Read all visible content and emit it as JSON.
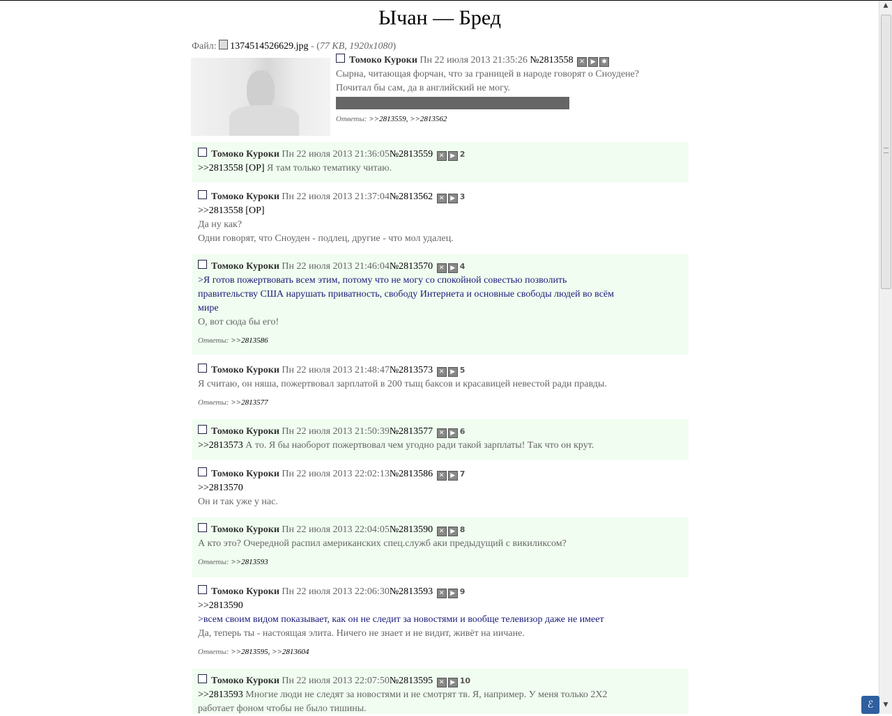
{
  "title": "Ычан — Бред",
  "op": {
    "file_label": "Файл:",
    "file_name": "1374514526629.jpg",
    "file_sep": " - (",
    "file_meta": "77 KB, 1920x1080",
    "file_close": ")",
    "name": "Томоко Куроки",
    "date": "Пн 22 июля 2013 21:35:26",
    "num": "№2813558",
    "lines": [
      "Сырна, читающая форчан, что за границей в народе говорят о Сноудене?",
      "Почитал бы сам, да в английский не могу."
    ],
    "replies_label": "Ответы:",
    "replies": ">>2813559, >>2813562"
  },
  "posts": [
    {
      "name": "Томоко Куроки",
      "date": "Пн 22 июля 2013 21:36:05",
      "num": "№2813559",
      "idx": "2",
      "l1_ref": ">>2813558 [OP]",
      "l1_text": " Я там только тематику читаю."
    },
    {
      "name": "Томоко Куроки",
      "date": "Пн 22 июля 2013 21:37:04",
      "num": "№2813562",
      "idx": "3",
      "l1": ">>2813558 [OP]",
      "l2": "Да ну как?",
      "l3": "Одни говорят, что Сноуден - подлец, другие - что мол удалец."
    },
    {
      "name": "Томоко Куроки",
      "date": "Пн 22 июля 2013 21:46:04",
      "num": "№2813570",
      "idx": "4",
      "quote1": ">Я готов пожертвовать всем этим, потому что не могу со спокойной совестью позволить",
      "quote2": "правительству США нарушать приватность, свободу Интернета и основные свободы людей во всём",
      "quote3": "мире",
      "l2": "О, вот сюда бы его!",
      "replies_label": "Ответы:",
      "replies": ">>2813586"
    },
    {
      "name": "Томоко Куроки",
      "date": "Пн 22 июля 2013 21:48:47",
      "num": "№2813573",
      "idx": "5",
      "l1": "Я считаю, он няша, пожертвовал зарплатой в 200 тыщ баксов и красавицей невестой ради правды.",
      "replies_label": "Ответы:",
      "replies": ">>2813577"
    },
    {
      "name": "Томоко Куроки",
      "date": "Пн 22 июля 2013 21:50:39",
      "num": "№2813577",
      "idx": "6",
      "l1_ref": ">>2813573",
      "l1_text": " А то. Я бы наоборот пожертвовал чем угодно ради такой зарплаты! Так что он крут."
    },
    {
      "name": "Томоко Куроки",
      "date": "Пн 22 июля 2013 22:02:13",
      "num": "№2813586",
      "idx": "7",
      "l1": ">>2813570",
      "l2": "Он и так уже у нас."
    },
    {
      "name": "Томоко Куроки",
      "date": "Пн 22 июля 2013 22:04:05",
      "num": "№2813590",
      "idx": "8",
      "l1": "А кто это? Очередной распил американских спец.служб аки предыдущий с викиликсом?",
      "replies_label": "Ответы:",
      "replies": ">>2813593"
    },
    {
      "name": "Томоко Куроки",
      "date": "Пн 22 июля 2013 22:06:30",
      "num": "№2813593",
      "idx": "9",
      "l1": ">>2813590",
      "quote1": ">всем своим видом показывает, как он не следит за новостями и вообще телевизор даже не имеет",
      "l3": "Да, теперь ты - настоящая элита. Ничего не знает и не видит, живёт на иичане.",
      "replies_label": "Ответы:",
      "replies": ">>2813595, >>2813604"
    },
    {
      "name": "Томоко Куроки",
      "date": "Пн 22 июля 2013 22:07:50",
      "num": "№2813595",
      "idx": "10",
      "l1_ref": ">>2813593",
      "l1_text": " Многие люди не следят за новостями и не смотрят тв. Я, например. У меня только 2Х2",
      "l2": "работает фоном чтобы не было тишины."
    }
  ],
  "icons": {
    "hide": "✕",
    "reply": "▶",
    "star": "✱"
  }
}
